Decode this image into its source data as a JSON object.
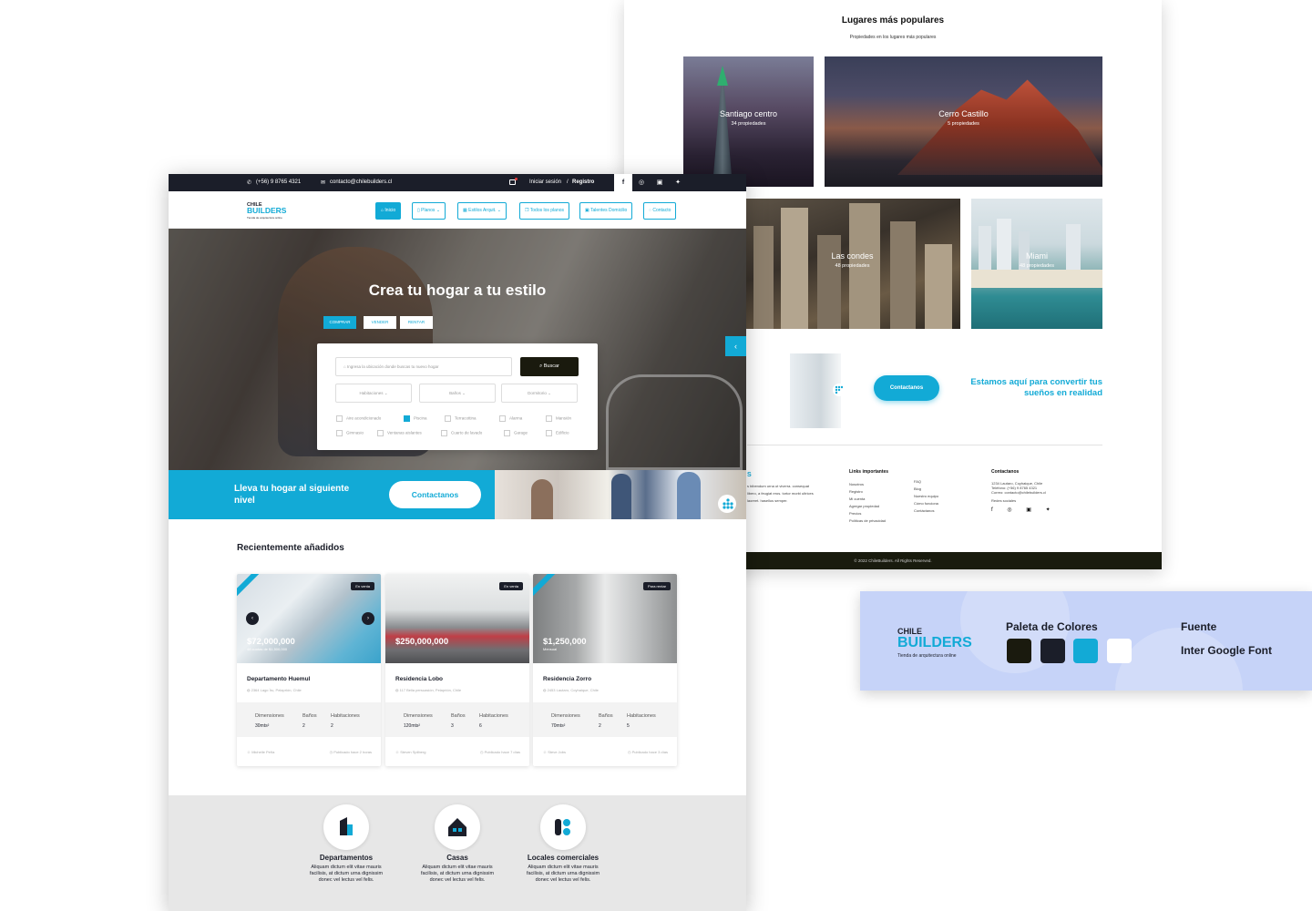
{
  "back_page": {
    "popular_title": "Lugares más populares",
    "popular_subtitle": "Propiedades en los lugares más populares",
    "places": [
      {
        "name": "Santiago centro",
        "count": "34 propiedades"
      },
      {
        "name": "Cerro Castillo",
        "count": "5 propiedades"
      },
      {
        "name": "Las condes",
        "count": "48 propiedades"
      },
      {
        "name": "Miami",
        "count": "48 propiedades"
      }
    ],
    "cta_button": "Contactanos",
    "cta_text": "Estamos aquí para convertir tus sueños en realidad",
    "footer": {
      "about_fragment": "s bibendum urna ut viverra. consequat libero, a feugiat eros. tortor morbi ultrices laoreet. hasellus semper.",
      "links_head": "Links importantes",
      "links_col1": [
        "Nosotros",
        "Registro",
        "Mi cuenta",
        "Agregar propiedad",
        "Precios",
        "Políticas de privacidad"
      ],
      "links_col2": [
        "FAQ",
        "Blog",
        "Nuestro equipo",
        "Cómo funciona",
        "Contáctanos"
      ],
      "contact_head": "Contactanos",
      "contact_lines": [
        "1234 Lautaro, Coyhaique, Chile",
        "Teléfono: (+56) 9 8765 4321",
        "Correo: contacto@chilebuilders.cl"
      ],
      "social_head": "Redes sociales",
      "copyright": "© 2022 ChileBuilders. All Rights Reserved."
    }
  },
  "palette_card": {
    "logo_top": "CHILE",
    "logo_main": "BUILDERS",
    "logo_tagline": "Tienda de arquitectura online",
    "palette_title": "Paleta de Colores",
    "font_title": "Fuente",
    "font_name": "Inter Google Font",
    "colors": [
      "#1a1a0e",
      "#1b1e29",
      "#12aad6",
      "#ffffff"
    ]
  },
  "main_page": {
    "topbar": {
      "phone": "(+56) 9 8765 4321",
      "email": "contacto@chilebuilders.cl",
      "login": "Iniciar sesión",
      "separator": "/",
      "register": "Registro"
    },
    "logo": {
      "top": "CHILE",
      "main": "BUILDERS",
      "tagline": "Tienda de arquitectura online"
    },
    "nav": [
      "Inicio",
      "Planos",
      "Estilos Arquit.",
      "Todos los planos",
      "Talentes Domicilio",
      "Contacto"
    ],
    "hero": {
      "title": "Crea tu hogar a tu estilo",
      "tabs": [
        "COMPRAR",
        "VENDER",
        "RENTAR"
      ],
      "search_placeholder": "Ingresa la ubicación donde buscas tu nuevo hogar",
      "search_button": "Buscar",
      "selects": [
        "Habitaciones",
        "Baños",
        "Dormitorio"
      ],
      "checkboxes": [
        {
          "label": "Aire acondicionado",
          "checked": false
        },
        {
          "label": "Piscina",
          "checked": true
        },
        {
          "label": "Terracottina",
          "checked": false
        },
        {
          "label": "Alarma",
          "checked": false
        },
        {
          "label": "Mansión",
          "checked": false
        },
        {
          "label": "Gimnasio",
          "checked": false
        },
        {
          "label": "Ventanas aislantes",
          "checked": false
        },
        {
          "label": "Cuarto de lavado",
          "checked": false
        },
        {
          "label": "Garage",
          "checked": false
        },
        {
          "label": "Edificio",
          "checked": false
        }
      ]
    },
    "promo": {
      "text": "Lleva tu hogar al siguiente nivel",
      "button": "Contactanos"
    },
    "recent_title": "Recientemente añadidos",
    "listings": [
      {
        "tag": "En venta",
        "price": "$72,000,000",
        "price_sub": "48 cuotas de $1,500,000",
        "name": "Departamento Huemul",
        "address": "2364 Lago Ìru, Pelaprión, Chile",
        "spec_heads": [
          "Dimensiones",
          "Baños",
          "Habitaciones"
        ],
        "spec_values": [
          "30mts²",
          "2",
          "2"
        ],
        "agent": "Michelle Peña",
        "published": "Publicado hace 2 horas"
      },
      {
        "tag": "En venta",
        "price": "$250,000,000",
        "price_sub": "",
        "name": "Residencia Lobo",
        "address": "117 Bella persuasión, Pelaprión, Chile",
        "spec_heads": [
          "Dimensiones",
          "Baños",
          "Habitaciones"
        ],
        "spec_values": [
          "120mts²",
          "3",
          "6"
        ],
        "agent": "Steven Spilberg",
        "published": "Publicado hace 7 días"
      },
      {
        "tag": "Para rentar",
        "price": "$1,250,000",
        "price_sub": "Mensual",
        "name": "Residencia Zorro",
        "address": "2453 Lautaro, Coyhaique, Chile",
        "spec_heads": [
          "Dimensiones",
          "Baños",
          "Habitaciones"
        ],
        "spec_values": [
          "70mts²",
          "2",
          "5"
        ],
        "agent": "Steve Jobs",
        "published": "Publicado hace 3 días"
      }
    ],
    "categories": [
      {
        "title": "Departamentos",
        "desc": "Aliquam dictum elit vitae mauris facilisis, at dictum urna dignissim donec vel lectus vel felis."
      },
      {
        "title": "Casas",
        "desc": "Aliquam dictum elit vitae mauris facilisis, at dictum urna dignissim donec vel lectus vel felis."
      },
      {
        "title": "Locales comerciales",
        "desc": "Aliquam dictum elit vitae mauris facilisis, at dictum urna dignissim donec vel lectus vel felis."
      }
    ]
  }
}
